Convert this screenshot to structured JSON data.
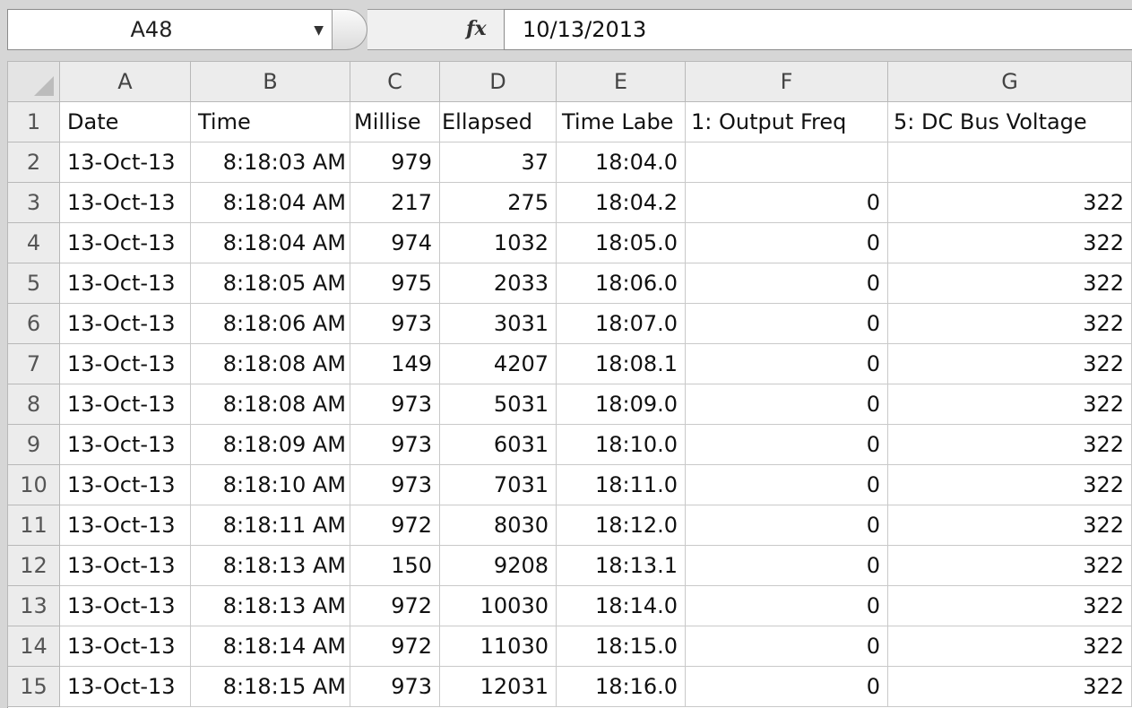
{
  "formula_bar": {
    "name_box": "A48",
    "fx_label": "fx",
    "formula_value": "10/13/2013",
    "dropdown_icon": "chevron-down-icon"
  },
  "columns": [
    "A",
    "B",
    "C",
    "D",
    "E",
    "F",
    "G"
  ],
  "header_row": {
    "row_number": "1",
    "cells": [
      "Date",
      "Time",
      "Millise",
      "Ellapsed",
      "Time Labe",
      "1: Output Freq",
      "5: DC Bus Voltage"
    ]
  },
  "rows": [
    {
      "n": "2",
      "date": "13-Oct-13",
      "time": "8:18:03 AM",
      "ms": "979",
      "elapsed": "37",
      "label": "18:04.0",
      "freq": "",
      "volt": ""
    },
    {
      "n": "3",
      "date": "13-Oct-13",
      "time": "8:18:04 AM",
      "ms": "217",
      "elapsed": "275",
      "label": "18:04.2",
      "freq": "0",
      "volt": "322"
    },
    {
      "n": "4",
      "date": "13-Oct-13",
      "time": "8:18:04 AM",
      "ms": "974",
      "elapsed": "1032",
      "label": "18:05.0",
      "freq": "0",
      "volt": "322"
    },
    {
      "n": "5",
      "date": "13-Oct-13",
      "time": "8:18:05 AM",
      "ms": "975",
      "elapsed": "2033",
      "label": "18:06.0",
      "freq": "0",
      "volt": "322"
    },
    {
      "n": "6",
      "date": "13-Oct-13",
      "time": "8:18:06 AM",
      "ms": "973",
      "elapsed": "3031",
      "label": "18:07.0",
      "freq": "0",
      "volt": "322"
    },
    {
      "n": "7",
      "date": "13-Oct-13",
      "time": "8:18:08 AM",
      "ms": "149",
      "elapsed": "4207",
      "label": "18:08.1",
      "freq": "0",
      "volt": "322"
    },
    {
      "n": "8",
      "date": "13-Oct-13",
      "time": "8:18:08 AM",
      "ms": "973",
      "elapsed": "5031",
      "label": "18:09.0",
      "freq": "0",
      "volt": "322"
    },
    {
      "n": "9",
      "date": "13-Oct-13",
      "time": "8:18:09 AM",
      "ms": "973",
      "elapsed": "6031",
      "label": "18:10.0",
      "freq": "0",
      "volt": "322"
    },
    {
      "n": "10",
      "date": "13-Oct-13",
      "time": "8:18:10 AM",
      "ms": "973",
      "elapsed": "7031",
      "label": "18:11.0",
      "freq": "0",
      "volt": "322"
    },
    {
      "n": "11",
      "date": "13-Oct-13",
      "time": "8:18:11 AM",
      "ms": "972",
      "elapsed": "8030",
      "label": "18:12.0",
      "freq": "0",
      "volt": "322"
    },
    {
      "n": "12",
      "date": "13-Oct-13",
      "time": "8:18:13 AM",
      "ms": "150",
      "elapsed": "9208",
      "label": "18:13.1",
      "freq": "0",
      "volt": "322"
    },
    {
      "n": "13",
      "date": "13-Oct-13",
      "time": "8:18:13 AM",
      "ms": "972",
      "elapsed": "10030",
      "label": "18:14.0",
      "freq": "0",
      "volt": "322"
    },
    {
      "n": "14",
      "date": "13-Oct-13",
      "time": "8:18:14 AM",
      "ms": "972",
      "elapsed": "11030",
      "label": "18:15.0",
      "freq": "0",
      "volt": "322"
    },
    {
      "n": "15",
      "date": "13-Oct-13",
      "time": "8:18:15 AM",
      "ms": "973",
      "elapsed": "12031",
      "label": "18:16.0",
      "freq": "0",
      "volt": "322"
    }
  ]
}
